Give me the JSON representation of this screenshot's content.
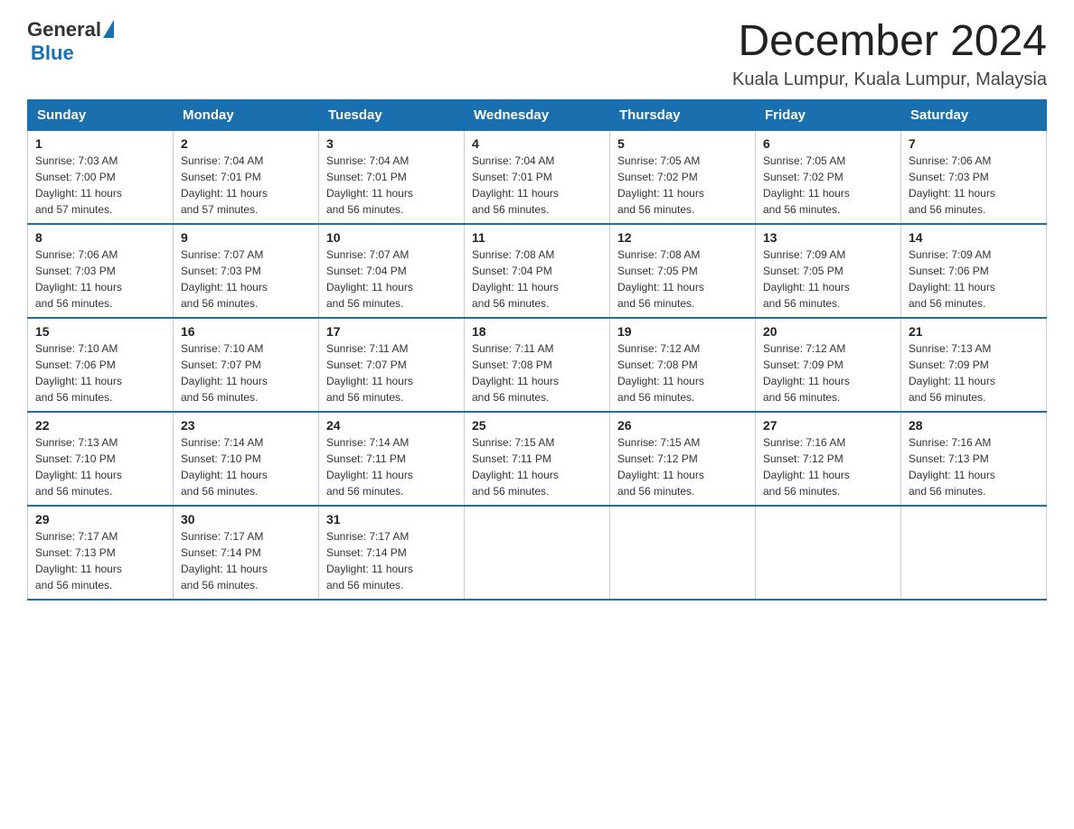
{
  "header": {
    "logo": {
      "general": "General",
      "blue": "Blue"
    },
    "title": "December 2024",
    "location": "Kuala Lumpur, Kuala Lumpur, Malaysia"
  },
  "days_of_week": [
    "Sunday",
    "Monday",
    "Tuesday",
    "Wednesday",
    "Thursday",
    "Friday",
    "Saturday"
  ],
  "weeks": [
    [
      {
        "day": "1",
        "sunrise": "7:03 AM",
        "sunset": "7:00 PM",
        "daylight": "11 hours and 57 minutes."
      },
      {
        "day": "2",
        "sunrise": "7:04 AM",
        "sunset": "7:01 PM",
        "daylight": "11 hours and 57 minutes."
      },
      {
        "day": "3",
        "sunrise": "7:04 AM",
        "sunset": "7:01 PM",
        "daylight": "11 hours and 56 minutes."
      },
      {
        "day": "4",
        "sunrise": "7:04 AM",
        "sunset": "7:01 PM",
        "daylight": "11 hours and 56 minutes."
      },
      {
        "day": "5",
        "sunrise": "7:05 AM",
        "sunset": "7:02 PM",
        "daylight": "11 hours and 56 minutes."
      },
      {
        "day": "6",
        "sunrise": "7:05 AM",
        "sunset": "7:02 PM",
        "daylight": "11 hours and 56 minutes."
      },
      {
        "day": "7",
        "sunrise": "7:06 AM",
        "sunset": "7:03 PM",
        "daylight": "11 hours and 56 minutes."
      }
    ],
    [
      {
        "day": "8",
        "sunrise": "7:06 AM",
        "sunset": "7:03 PM",
        "daylight": "11 hours and 56 minutes."
      },
      {
        "day": "9",
        "sunrise": "7:07 AM",
        "sunset": "7:03 PM",
        "daylight": "11 hours and 56 minutes."
      },
      {
        "day": "10",
        "sunrise": "7:07 AM",
        "sunset": "7:04 PM",
        "daylight": "11 hours and 56 minutes."
      },
      {
        "day": "11",
        "sunrise": "7:08 AM",
        "sunset": "7:04 PM",
        "daylight": "11 hours and 56 minutes."
      },
      {
        "day": "12",
        "sunrise": "7:08 AM",
        "sunset": "7:05 PM",
        "daylight": "11 hours and 56 minutes."
      },
      {
        "day": "13",
        "sunrise": "7:09 AM",
        "sunset": "7:05 PM",
        "daylight": "11 hours and 56 minutes."
      },
      {
        "day": "14",
        "sunrise": "7:09 AM",
        "sunset": "7:06 PM",
        "daylight": "11 hours and 56 minutes."
      }
    ],
    [
      {
        "day": "15",
        "sunrise": "7:10 AM",
        "sunset": "7:06 PM",
        "daylight": "11 hours and 56 minutes."
      },
      {
        "day": "16",
        "sunrise": "7:10 AM",
        "sunset": "7:07 PM",
        "daylight": "11 hours and 56 minutes."
      },
      {
        "day": "17",
        "sunrise": "7:11 AM",
        "sunset": "7:07 PM",
        "daylight": "11 hours and 56 minutes."
      },
      {
        "day": "18",
        "sunrise": "7:11 AM",
        "sunset": "7:08 PM",
        "daylight": "11 hours and 56 minutes."
      },
      {
        "day": "19",
        "sunrise": "7:12 AM",
        "sunset": "7:08 PM",
        "daylight": "11 hours and 56 minutes."
      },
      {
        "day": "20",
        "sunrise": "7:12 AM",
        "sunset": "7:09 PM",
        "daylight": "11 hours and 56 minutes."
      },
      {
        "day": "21",
        "sunrise": "7:13 AM",
        "sunset": "7:09 PM",
        "daylight": "11 hours and 56 minutes."
      }
    ],
    [
      {
        "day": "22",
        "sunrise": "7:13 AM",
        "sunset": "7:10 PM",
        "daylight": "11 hours and 56 minutes."
      },
      {
        "day": "23",
        "sunrise": "7:14 AM",
        "sunset": "7:10 PM",
        "daylight": "11 hours and 56 minutes."
      },
      {
        "day": "24",
        "sunrise": "7:14 AM",
        "sunset": "7:11 PM",
        "daylight": "11 hours and 56 minutes."
      },
      {
        "day": "25",
        "sunrise": "7:15 AM",
        "sunset": "7:11 PM",
        "daylight": "11 hours and 56 minutes."
      },
      {
        "day": "26",
        "sunrise": "7:15 AM",
        "sunset": "7:12 PM",
        "daylight": "11 hours and 56 minutes."
      },
      {
        "day": "27",
        "sunrise": "7:16 AM",
        "sunset": "7:12 PM",
        "daylight": "11 hours and 56 minutes."
      },
      {
        "day": "28",
        "sunrise": "7:16 AM",
        "sunset": "7:13 PM",
        "daylight": "11 hours and 56 minutes."
      }
    ],
    [
      {
        "day": "29",
        "sunrise": "7:17 AM",
        "sunset": "7:13 PM",
        "daylight": "11 hours and 56 minutes."
      },
      {
        "day": "30",
        "sunrise": "7:17 AM",
        "sunset": "7:14 PM",
        "daylight": "11 hours and 56 minutes."
      },
      {
        "day": "31",
        "sunrise": "7:17 AM",
        "sunset": "7:14 PM",
        "daylight": "11 hours and 56 minutes."
      },
      null,
      null,
      null,
      null
    ]
  ],
  "labels": {
    "sunrise": "Sunrise:",
    "sunset": "Sunset:",
    "daylight": "Daylight:"
  }
}
